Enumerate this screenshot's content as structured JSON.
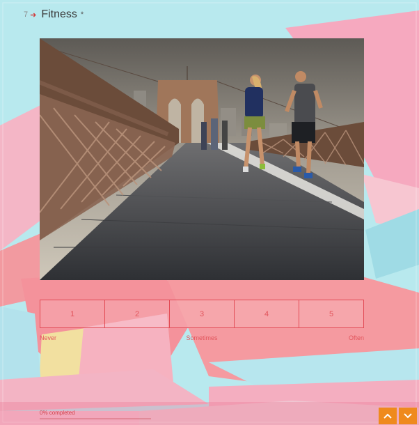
{
  "question": {
    "number": "7",
    "title": "Fitness",
    "required_mark": "*"
  },
  "image": {
    "subject": "people running across a bridge walkway"
  },
  "scale": {
    "options": [
      "1",
      "2",
      "3",
      "4",
      "5"
    ],
    "label_low": "Never",
    "label_mid": "Sometimes",
    "label_high": "Often"
  },
  "progress": {
    "text": "0% completed",
    "fraction": 0
  },
  "nav": {
    "up_icon": "chevron-up-icon",
    "down_icon": "chevron-down-icon"
  },
  "colors": {
    "accent": "#e24a55",
    "nav_button": "#ef8a1d",
    "background": "#b8e9ee"
  }
}
